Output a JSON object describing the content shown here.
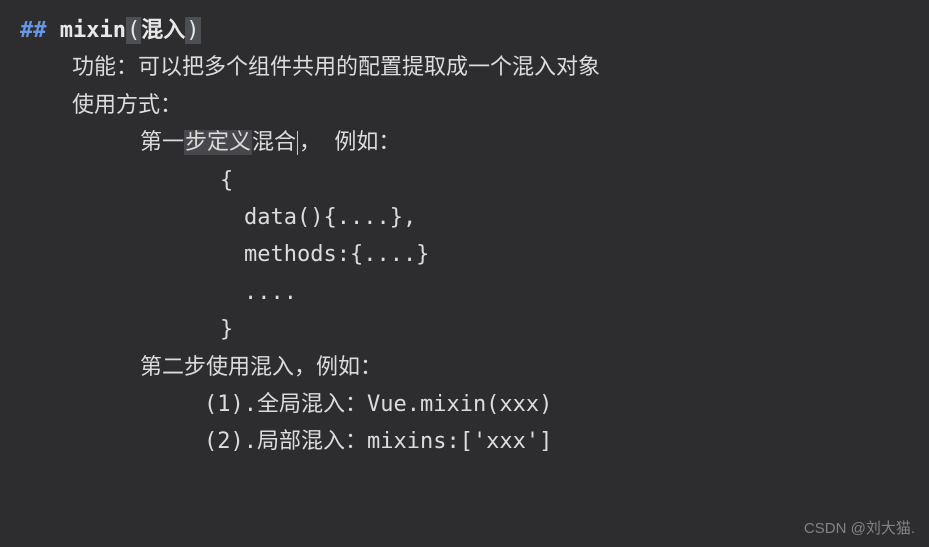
{
  "header": {
    "hash": "##",
    "title": "mixin",
    "title_bracket_open": "(",
    "title_cn": "混入",
    "title_bracket_close": ")"
  },
  "line_function": "功能：可以把多个组件共用的配置提取成一个混入对象",
  "line_usage": "使用方式：",
  "step1": {
    "prefix": "第一",
    "hl": "步定义",
    "mid": "混合",
    "cursor_after": "，",
    "suffix": "例如："
  },
  "code": {
    "open_brace": "{",
    "data_line": "data(){....},",
    "methods_line": "methods:{....}",
    "dots": "....",
    "close_brace": "}"
  },
  "step2": "第二步使用混入，例如：",
  "sub1": "(1).全局混入：Vue.mixin(xxx)",
  "sub2": "(2).局部混入：mixins:['xxx']",
  "watermark": "CSDN @刘大猫."
}
